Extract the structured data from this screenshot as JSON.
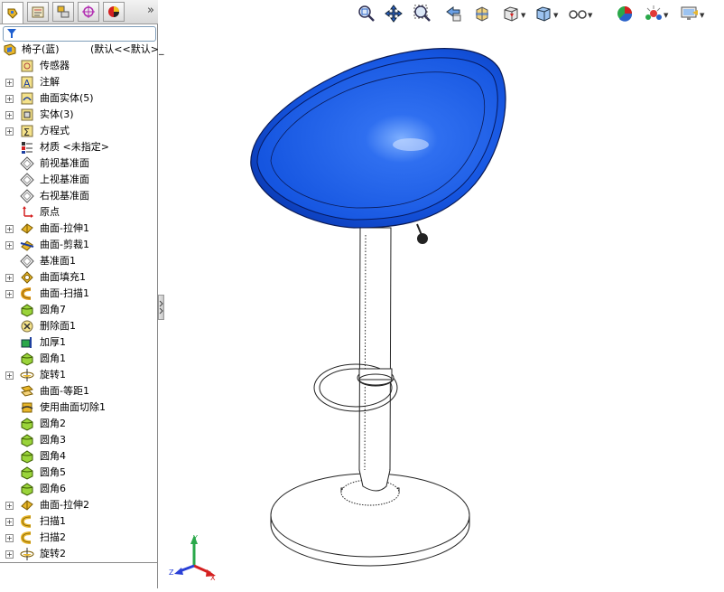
{
  "feature_tree": {
    "root": {
      "label": "椅子(蓝)",
      "extra": "(默认<<默认>_"
    },
    "items": [
      {
        "label": "传感器",
        "icon": "sensor-icon",
        "expandable": false
      },
      {
        "label": "注解",
        "icon": "annotation-icon",
        "expandable": true
      },
      {
        "label": "曲面实体(5)",
        "icon": "surface-bodies-icon",
        "expandable": true
      },
      {
        "label": "实体(3)",
        "icon": "solid-bodies-icon",
        "expandable": true
      },
      {
        "label": "方程式",
        "icon": "equation-icon",
        "expandable": true
      },
      {
        "label": "材质 <未指定>",
        "icon": "material-icon",
        "expandable": false
      },
      {
        "label": "前视基准面",
        "icon": "plane-icon",
        "expandable": false
      },
      {
        "label": "上视基准面",
        "icon": "plane-icon",
        "expandable": false
      },
      {
        "label": "右视基准面",
        "icon": "plane-icon",
        "expandable": false
      },
      {
        "label": "原点",
        "icon": "origin-icon",
        "expandable": false
      },
      {
        "label": "曲面-拉伸1",
        "icon": "surface-extrude-icon",
        "expandable": true
      },
      {
        "label": "曲面-剪裁1",
        "icon": "surface-trim-icon",
        "expandable": true
      },
      {
        "label": "基准面1",
        "icon": "plane-icon",
        "expandable": false
      },
      {
        "label": "曲面填充1",
        "icon": "surface-fill-icon",
        "expandable": true
      },
      {
        "label": "曲面-扫描1",
        "icon": "surface-sweep-icon",
        "expandable": true
      },
      {
        "label": "圆角7",
        "icon": "fillet-icon",
        "expandable": false
      },
      {
        "label": "删除面1",
        "icon": "delete-face-icon",
        "expandable": false
      },
      {
        "label": "加厚1",
        "icon": "thicken-icon",
        "expandable": false
      },
      {
        "label": "圆角1",
        "icon": "fillet-icon",
        "expandable": false
      },
      {
        "label": "旋转1",
        "icon": "revolve-icon",
        "expandable": true
      },
      {
        "label": "曲面-等距1",
        "icon": "surface-offset-icon",
        "expandable": false
      },
      {
        "label": "使用曲面切除1",
        "icon": "cut-with-surface-icon",
        "expandable": false
      },
      {
        "label": "圆角2",
        "icon": "fillet-icon",
        "expandable": false
      },
      {
        "label": "圆角3",
        "icon": "fillet-icon",
        "expandable": false
      },
      {
        "label": "圆角4",
        "icon": "fillet-icon",
        "expandable": false
      },
      {
        "label": "圆角5",
        "icon": "fillet-icon",
        "expandable": false
      },
      {
        "label": "圆角6",
        "icon": "fillet-icon",
        "expandable": false
      },
      {
        "label": "曲面-拉伸2",
        "icon": "surface-extrude-icon",
        "expandable": true
      },
      {
        "label": "扫描1",
        "icon": "sweep-icon",
        "expandable": true
      },
      {
        "label": "扫描2",
        "icon": "sweep-icon",
        "expandable": true
      },
      {
        "label": "旋转2",
        "icon": "revolve-icon",
        "expandable": true
      }
    ]
  },
  "panel_tabs": [
    "feature-manager-tab-icon",
    "property-manager-tab-icon",
    "configuration-manager-tab-icon",
    "dimxpert-tab-icon",
    "display-manager-tab-icon"
  ],
  "panel_more": "»",
  "view_toolbar": [
    "zoom-to-fit-icon",
    "pan-icon",
    "zoom-to-area-icon",
    "previous-view-icon",
    "section-view-icon",
    "view-orientation-icon",
    "display-style-icon",
    "hide-show-items-icon",
    "edit-appearance-icon",
    "apply-scene-icon",
    "view-settings-icon"
  ],
  "triad": {
    "x": "X",
    "y": "Y",
    "z": "Z"
  },
  "colors": {
    "seat_blue": "#1555e0",
    "seat_dark": "#0a2f9a",
    "panel_border": "#8a8a8a",
    "tree_plus": "#8a8a8a"
  }
}
